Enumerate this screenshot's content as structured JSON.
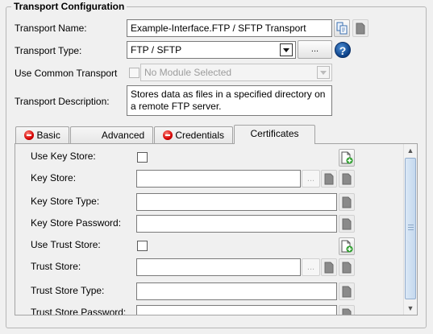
{
  "title": "Transport Configuration",
  "form": {
    "name_label": "Transport Name:",
    "name_value": "Example-Interface.FTP / SFTP Transport",
    "type_label": "Transport Type:",
    "type_value": "FTP / SFTP",
    "type_button_label": "...",
    "help_glyph": "?",
    "common_label": "Use Common Transport",
    "common_placeholder": "No Module Selected",
    "desc_label": "Transport Description:",
    "desc_value": "Stores data as files in a specified directory on a remote FTP server."
  },
  "tabs": [
    {
      "label": "Basic",
      "error": true
    },
    {
      "label": "Advanced",
      "error": false
    },
    {
      "label": "Credentials",
      "error": true
    },
    {
      "label": "Certificates",
      "error": false,
      "active": true
    }
  ],
  "certificates": {
    "use_key_store": "Use Key Store:",
    "key_store": "Key Store:",
    "key_store_type": "Key Store Type:",
    "key_store_password": "Key Store Password:",
    "use_trust_store": "Use Trust Store:",
    "trust_store": "Trust Store:",
    "trust_store_type": "Trust Store Type:",
    "trust_store_password": "Trust Store Password:",
    "browse_label": "..."
  },
  "icons": {
    "copy": "copy-icon",
    "delete": "delete-icon",
    "new_document": "new-document-icon",
    "help": "help-icon"
  },
  "colors": {
    "background": "#f0f0f0",
    "error": "#d40000",
    "help": "#0b3f85",
    "add": "#2a9d2a"
  }
}
